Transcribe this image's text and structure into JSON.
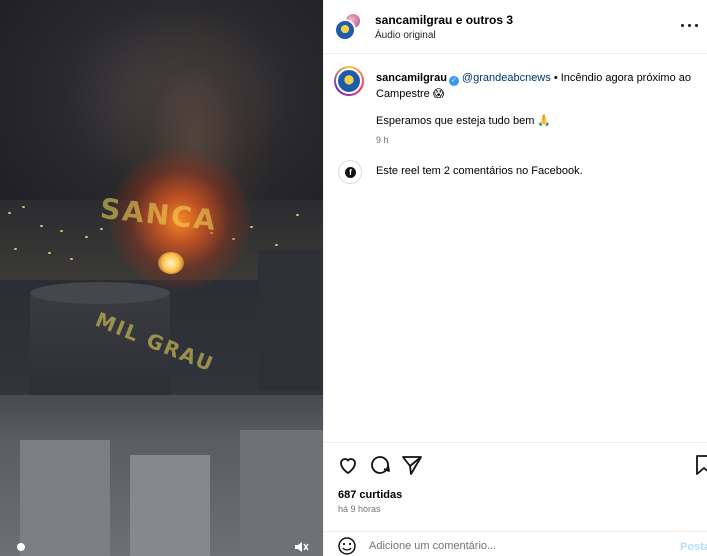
{
  "video": {
    "watermark_line1": "SANCA",
    "watermark_line2": "MIL GRAU"
  },
  "header": {
    "title": "sancamilgrau e outros 3",
    "audio": "Áudio original"
  },
  "caption": {
    "username": "sancamilgrau",
    "mention": "@grandeabcnews",
    "text_part1": " • Incêndio agora próximo ao Campestre 😱",
    "line2": "Esperamos que esteja tudo bem 🙏",
    "time": "9 h"
  },
  "facebook": {
    "text": "Este reel tem 2 comentários no Facebook."
  },
  "stats": {
    "likes": "687 curtidas",
    "posted": "há 9 horas"
  },
  "comment": {
    "placeholder": "Adicione um comentário...",
    "post_label": "Postar"
  },
  "colors": {
    "verified": "#3897f0",
    "mention": "#00376b",
    "post_button": "#b2dffc"
  }
}
